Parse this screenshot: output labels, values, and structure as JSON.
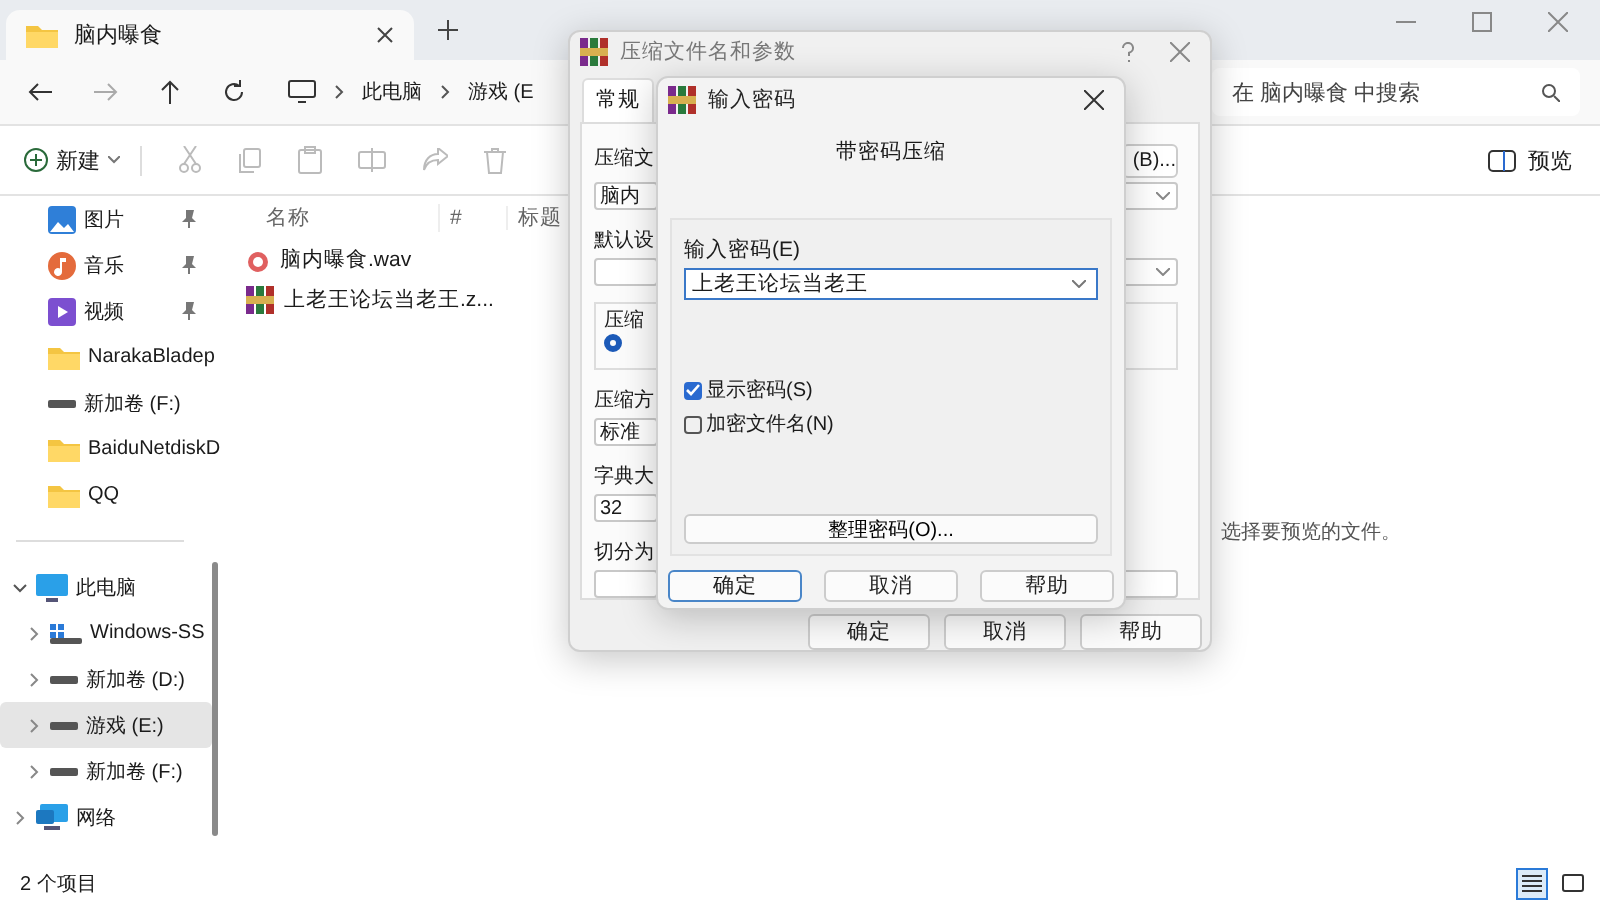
{
  "explorer": {
    "tab_title": "脑内曝食",
    "breadcrumbs": [
      "此电脑",
      "游戏 (E"
    ],
    "search": {
      "placeholder": "在 脑内曝食 中搜索"
    },
    "toolbar": {
      "new_label": "新建",
      "preview_label": "预览"
    },
    "sidebar": {
      "items": [
        {
          "label": "图片",
          "kind": "pictures",
          "pinned": true,
          "selected": false
        },
        {
          "label": "音乐",
          "kind": "music",
          "pinned": true,
          "selected": false
        },
        {
          "label": "视频",
          "kind": "video",
          "pinned": true,
          "selected": false
        },
        {
          "label": "NarakaBladep",
          "kind": "folder",
          "pinned": false,
          "selected": false
        },
        {
          "label": "新加卷 (F:)",
          "kind": "drive",
          "pinned": false,
          "selected": false
        },
        {
          "label": "BaiduNetdiskD",
          "kind": "folder",
          "pinned": false,
          "selected": false
        },
        {
          "label": "QQ",
          "kind": "folder",
          "pinned": false,
          "selected": false
        },
        {
          "label": "此电脑",
          "kind": "pc",
          "selected": false,
          "expanded": true,
          "children": [
            {
              "label": "Windows-SS",
              "kind": "windrive",
              "selected": false,
              "expanded": false
            },
            {
              "label": "新加卷 (D:)",
              "kind": "drive",
              "selected": false,
              "expanded": false
            },
            {
              "label": "游戏 (E:)",
              "kind": "drive",
              "selected": true,
              "expanded": false
            },
            {
              "label": "新加卷 (F:)",
              "kind": "drive",
              "selected": false,
              "expanded": false
            }
          ]
        },
        {
          "label": "网络",
          "kind": "network",
          "selected": false,
          "expanded": false
        }
      ]
    },
    "columns": [
      "名称",
      "#",
      "标题"
    ],
    "files": [
      {
        "name": "脑内曝食.wav",
        "kind": "audio"
      },
      {
        "name": "上老王论坛当老王.z...",
        "kind": "archive"
      }
    ],
    "preview_hint": "选择要预览的文件。",
    "status": "2 个项目",
    "views": [
      {
        "kind": "details",
        "selected": true
      },
      {
        "kind": "tiles",
        "selected": false
      }
    ]
  },
  "archive_dialog": {
    "title": "压缩文件名和参数",
    "tabs": [
      {
        "label": "常规",
        "selected": true
      }
    ],
    "rows": [
      {
        "kind": "combo",
        "label": "压缩文",
        "value": "脑内",
        "browse": "(B)..."
      },
      {
        "kind": "combo",
        "label": "默认设"
      },
      {
        "kind": "group",
        "label": "压缩",
        "radio_selected": true
      },
      {
        "kind": "edit",
        "label": "压缩方",
        "value": "标准"
      },
      {
        "kind": "edit",
        "label": "字典大",
        "value": "32"
      },
      {
        "kind": "wide",
        "label": "切分为"
      }
    ],
    "buttons": [
      "确定",
      "取消",
      "帮助"
    ]
  },
  "password_dialog": {
    "title": "输入密码",
    "heading": "带密码压缩",
    "password": {
      "label": "输入密码(E)",
      "value": "上老王论坛当老王"
    },
    "options": [
      {
        "label": "显示密码(S)",
        "checked": true
      },
      {
        "label": "加密文件名(N)",
        "checked": false
      }
    ],
    "organize_button": "整理密码(O)...",
    "buttons": [
      {
        "label": "确定",
        "default": true
      },
      {
        "label": "取消",
        "default": false
      },
      {
        "label": "帮助",
        "default": false
      }
    ]
  }
}
